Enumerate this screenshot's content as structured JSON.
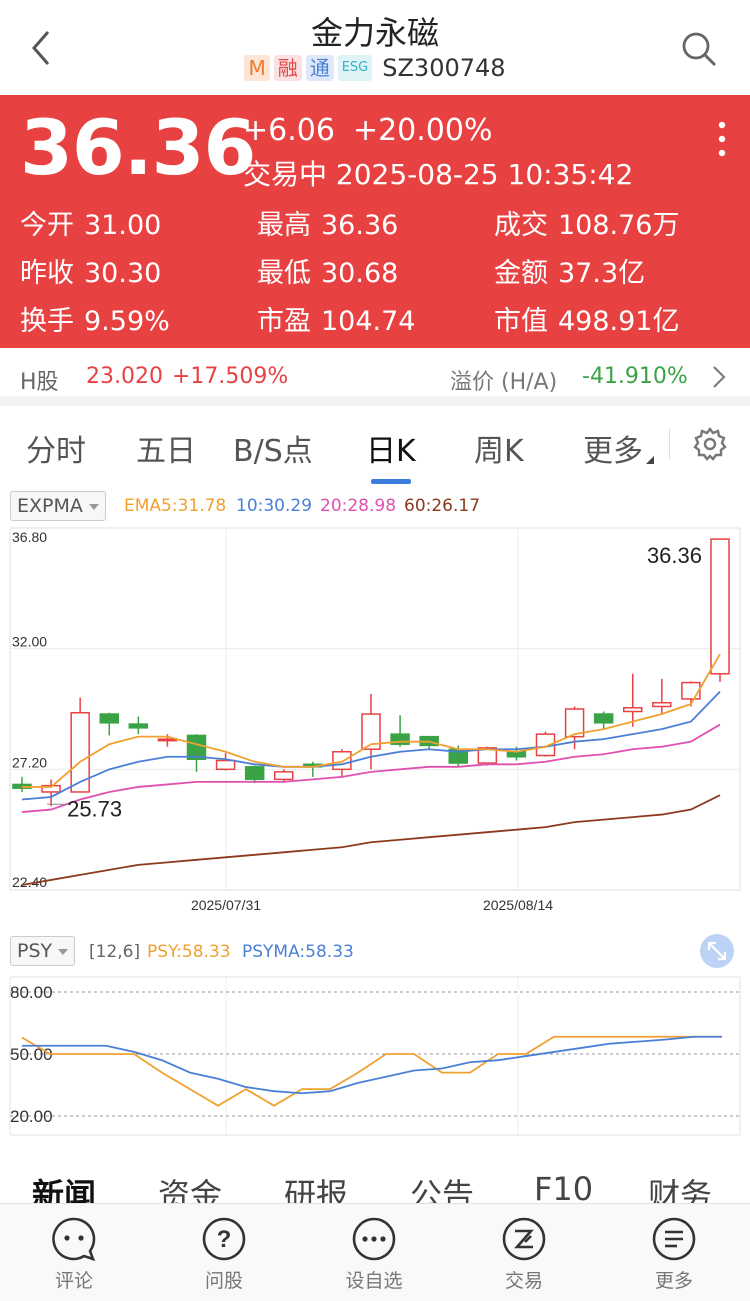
{
  "nav": {
    "title": "金力永磁",
    "badges": [
      "M",
      "融",
      "通",
      "ESG"
    ],
    "code": "SZ300748"
  },
  "quote": {
    "price": "36.36",
    "change": "+6.06",
    "change_pct": "+20.00%",
    "status": "交易中 2025-08-25 10:35:42",
    "stats": [
      {
        "label": "今开",
        "value": "31.00"
      },
      {
        "label": "最高",
        "value": "36.36"
      },
      {
        "label": "成交",
        "value": "108.76万"
      },
      {
        "label": "昨收",
        "value": "30.30"
      },
      {
        "label": "最低",
        "value": "30.68"
      },
      {
        "label": "金额",
        "value": "37.3亿"
      },
      {
        "label": "换手",
        "value": "9.59%"
      },
      {
        "label": "市盈",
        "value": "104.74"
      },
      {
        "label": "市值",
        "value": "498.91亿"
      }
    ]
  },
  "hshare": {
    "label": "H股",
    "price": "23.020",
    "pct": "+17.509%",
    "premium_label": "溢价 (H/A)",
    "premium": "-41.910%"
  },
  "tabs": [
    "分时",
    "五日",
    "B/S点",
    "日K",
    "周K",
    "更多"
  ],
  "colors": {
    "up": "#e84142",
    "down": "#3aa346",
    "ema5": "#f0a030",
    "ema10": "#4a7fd6",
    "ema20": "#e050b0",
    "ema60": "#8b3a1e"
  },
  "kline_indicator": {
    "name": "EXPMA",
    "ema5": "EMA5:31.78",
    "ema10": "10:30.29",
    "ema20": "20:28.98",
    "ema60": "60:26.17"
  },
  "psy_indicator": {
    "name": "PSY",
    "params": "[12,6]",
    "psy": "PSY:58.33",
    "psyma": "PSYMA:58.33"
  },
  "chart_data": [
    {
      "type": "candlestick",
      "ylim": [
        22.4,
        36.8
      ],
      "yticks": [
        "36.80",
        "32.00",
        "27.20",
        "22.40"
      ],
      "xticks": [
        "2025/07/31",
        "2025/08/14"
      ],
      "max_label": "36.36",
      "min_label": "25.73",
      "candles": [
        {
          "o": 26.6,
          "h": 26.9,
          "l": 26.3,
          "c": 26.45
        },
        {
          "o": 26.3,
          "h": 26.8,
          "l": 25.73,
          "c": 26.55
        },
        {
          "o": 26.3,
          "h": 30.05,
          "l": 26.3,
          "c": 29.45
        },
        {
          "o": 29.4,
          "h": 29.45,
          "l": 28.55,
          "c": 29.05
        },
        {
          "o": 29.0,
          "h": 29.3,
          "l": 28.6,
          "c": 28.85
        },
        {
          "o": 28.4,
          "h": 28.6,
          "l": 28.1,
          "c": 28.4
        },
        {
          "o": 28.55,
          "h": 28.6,
          "l": 27.1,
          "c": 27.6
        },
        {
          "o": 27.2,
          "h": 27.85,
          "l": 27.15,
          "c": 27.55
        },
        {
          "o": 27.3,
          "h": 27.35,
          "l": 26.65,
          "c": 26.8
        },
        {
          "o": 26.8,
          "h": 27.2,
          "l": 26.7,
          "c": 27.1
        },
        {
          "o": 27.4,
          "h": 27.5,
          "l": 26.9,
          "c": 27.3
        },
        {
          "o": 27.2,
          "h": 28.0,
          "l": 26.9,
          "c": 27.9
        },
        {
          "o": 28.0,
          "h": 30.2,
          "l": 27.2,
          "c": 29.4
        },
        {
          "o": 28.6,
          "h": 29.35,
          "l": 28.1,
          "c": 28.2
        },
        {
          "o": 28.5,
          "h": 28.5,
          "l": 28.0,
          "c": 28.15
        },
        {
          "o": 28.0,
          "h": 28.15,
          "l": 27.3,
          "c": 27.45
        },
        {
          "o": 27.45,
          "h": 28.1,
          "l": 27.35,
          "c": 28.05
        },
        {
          "o": 27.9,
          "h": 28.1,
          "l": 27.55,
          "c": 27.7
        },
        {
          "o": 27.75,
          "h": 28.7,
          "l": 27.7,
          "c": 28.6
        },
        {
          "o": 28.5,
          "h": 29.7,
          "l": 28.0,
          "c": 29.6
        },
        {
          "o": 29.4,
          "h": 29.5,
          "l": 28.8,
          "c": 29.05
        },
        {
          "o": 29.5,
          "h": 31.0,
          "l": 28.9,
          "c": 29.65
        },
        {
          "o": 29.7,
          "h": 30.8,
          "l": 29.4,
          "c": 29.85
        },
        {
          "o": 30.0,
          "h": 30.7,
          "l": 29.7,
          "c": 30.65
        },
        {
          "o": 31.0,
          "h": 36.36,
          "l": 30.68,
          "c": 36.36
        }
      ],
      "ema5": [
        26.5,
        26.5,
        27.5,
        28.2,
        28.5,
        28.5,
        28.2,
        27.9,
        27.5,
        27.3,
        27.3,
        27.5,
        28.2,
        28.3,
        28.3,
        28.0,
        28.0,
        27.9,
        28.1,
        28.6,
        28.8,
        29.1,
        29.4,
        29.8,
        31.78
      ],
      "ema10": [
        26.0,
        26.1,
        26.7,
        27.2,
        27.5,
        27.7,
        27.7,
        27.6,
        27.4,
        27.3,
        27.3,
        27.4,
        27.7,
        27.9,
        28.0,
        27.9,
        28.0,
        28.0,
        28.1,
        28.3,
        28.4,
        28.6,
        28.8,
        29.1,
        30.29
      ],
      "ema20": [
        25.5,
        25.6,
        26.0,
        26.3,
        26.5,
        26.6,
        26.7,
        26.7,
        26.7,
        26.7,
        26.8,
        26.9,
        27.1,
        27.2,
        27.3,
        27.3,
        27.4,
        27.4,
        27.5,
        27.7,
        27.8,
        28.0,
        28.1,
        28.3,
        28.98
      ],
      "ema60": [
        22.6,
        22.8,
        23.0,
        23.2,
        23.4,
        23.5,
        23.6,
        23.7,
        23.8,
        23.9,
        24.0,
        24.1,
        24.3,
        24.4,
        24.5,
        24.6,
        24.7,
        24.8,
        24.9,
        25.1,
        25.2,
        25.3,
        25.4,
        25.6,
        26.17
      ]
    },
    {
      "type": "line",
      "ylim": [
        20,
        80
      ],
      "yticks": [
        "80.00",
        "50.00",
        "20.00"
      ],
      "series": [
        {
          "name": "PSY",
          "values": [
            58,
            50,
            50,
            50,
            50,
            41,
            33,
            25,
            33,
            25,
            33,
            33,
            41,
            50,
            50,
            41,
            41,
            50,
            50,
            58.33,
            58.33,
            58.33,
            58.33,
            58.33,
            58.33,
            58.33
          ]
        },
        {
          "name": "PSYMA",
          "values": [
            54,
            54,
            54,
            54,
            51,
            47,
            41,
            38,
            34,
            32,
            31,
            32,
            36,
            39,
            42,
            43,
            46,
            47,
            49,
            51,
            53,
            55,
            56,
            57,
            58.33,
            58.33
          ]
        }
      ]
    }
  ],
  "subtabs": [
    "新闻",
    "资金",
    "研报",
    "公告",
    "F10",
    "财务"
  ],
  "bottom_bar": [
    "评论",
    "问股",
    "设自选",
    "交易",
    "更多"
  ]
}
